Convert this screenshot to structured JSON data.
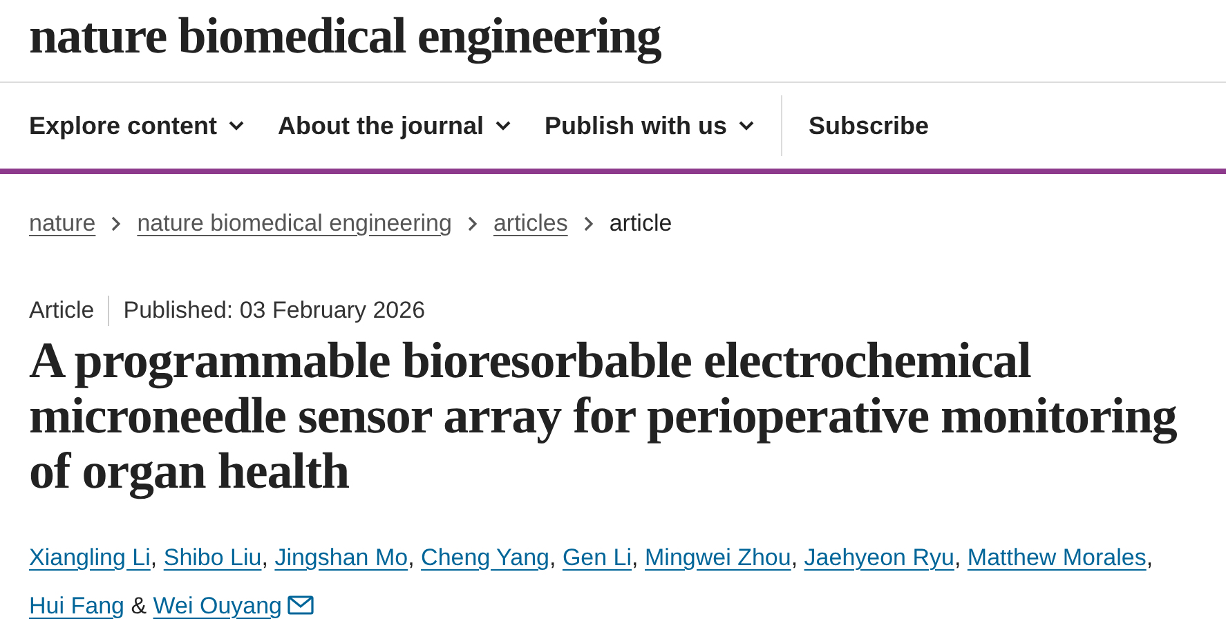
{
  "logo": "nature biomedical engineering",
  "nav": [
    {
      "label": "Explore content",
      "dropdown": true
    },
    {
      "label": "About the journal",
      "dropdown": true
    },
    {
      "label": "Publish with us",
      "dropdown": true
    },
    {
      "label": "Subscribe",
      "dropdown": false
    }
  ],
  "breadcrumb": [
    {
      "label": "nature",
      "link": true
    },
    {
      "label": "nature biomedical engineering",
      "link": true
    },
    {
      "label": "articles",
      "link": true
    },
    {
      "label": "article",
      "link": false
    }
  ],
  "article": {
    "type": "Article",
    "published": "Published: 03 February 2026",
    "title": "A programmable bioresorbable electrochemical microneedle sensor array for perioperative monitoring of organ health",
    "authors": [
      {
        "name": "Xiangling Li",
        "after": ",",
        "email": false
      },
      {
        "name": "Shibo Liu",
        "after": ",",
        "email": false
      },
      {
        "name": "Jingshan Mo",
        "after": ",",
        "email": false
      },
      {
        "name": "Cheng Yang",
        "after": ",",
        "email": false
      },
      {
        "name": "Gen Li",
        "after": ",",
        "email": false
      },
      {
        "name": "Mingwei Zhou",
        "after": ",",
        "email": false
      },
      {
        "name": "Jaehyeon Ryu",
        "after": ",",
        "email": false
      },
      {
        "name": "Matthew Morales",
        "after": ",",
        "email": false
      },
      {
        "name": "Hui Fang",
        "after": "&",
        "email": false
      },
      {
        "name": "Wei Ouyang",
        "email": true
      }
    ]
  }
}
